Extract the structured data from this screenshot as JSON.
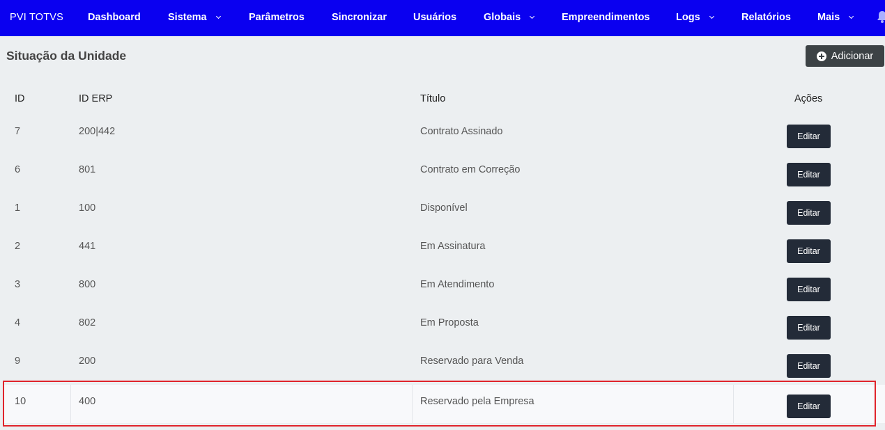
{
  "nav": {
    "brand": "PVI TOTVS",
    "items": [
      {
        "label": "Dashboard",
        "dropdown": false
      },
      {
        "label": "Sistema",
        "dropdown": true
      },
      {
        "label": "Parâmetros",
        "dropdown": false
      },
      {
        "label": "Sincronizar",
        "dropdown": false
      },
      {
        "label": "Usuários",
        "dropdown": false
      },
      {
        "label": "Globais",
        "dropdown": true
      },
      {
        "label": "Empreendimentos",
        "dropdown": false
      },
      {
        "label": "Logs",
        "dropdown": true
      },
      {
        "label": "Relatórios",
        "dropdown": false
      },
      {
        "label": "Mais",
        "dropdown": true
      }
    ],
    "icons": [
      "chevron-down-icon",
      "bell-icon"
    ]
  },
  "page": {
    "title": "Situação da Unidade",
    "add_label": "Adicionar",
    "add_icon": "plus-circle-icon"
  },
  "table": {
    "headers": {
      "id": "ID",
      "id_erp": "ID ERP",
      "title": "Título",
      "actions": "Ações"
    },
    "edit_label": "Editar",
    "rows": [
      {
        "id": "7",
        "id_erp": "200|442",
        "title": "Contrato Assinado"
      },
      {
        "id": "6",
        "id_erp": "801",
        "title": "Contrato em Correção"
      },
      {
        "id": "1",
        "id_erp": "100",
        "title": "Disponível"
      },
      {
        "id": "2",
        "id_erp": "441",
        "title": "Em Assinatura"
      },
      {
        "id": "3",
        "id_erp": "800",
        "title": "Em Atendimento"
      },
      {
        "id": "4",
        "id_erp": "802",
        "title": "Em Proposta"
      },
      {
        "id": "9",
        "id_erp": "200",
        "title": "Reservado para Venda"
      },
      {
        "id": "10",
        "id_erp": "400",
        "title": "Reservado pela Empresa",
        "highlighted": true
      }
    ]
  },
  "colors": {
    "navbar": "#0a00f0",
    "background": "#eceff1",
    "edit_button": "#232b38",
    "add_button": "#3c4245",
    "highlight_border": "#e0242b"
  }
}
